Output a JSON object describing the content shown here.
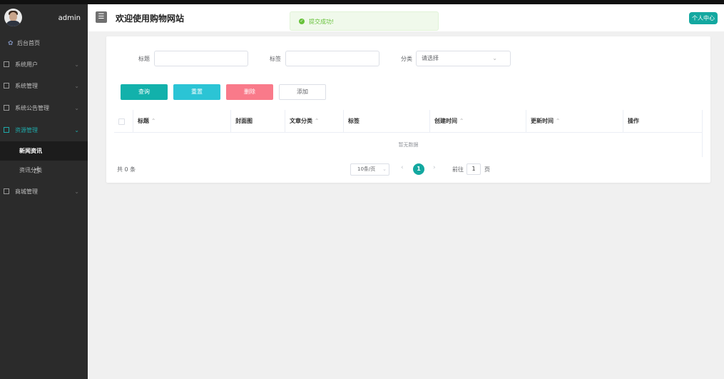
{
  "sidebar": {
    "username": "admin",
    "home_label": "后台首页",
    "menus": [
      {
        "label": "系统用户"
      },
      {
        "label": "系统管理"
      },
      {
        "label": "系统公告管理"
      },
      {
        "label": "资源管理"
      },
      {
        "label": "商城管理"
      }
    ],
    "submenus": [
      {
        "label": "新闻资讯"
      },
      {
        "label": "资讯分类"
      }
    ],
    "chevron": "⌄"
  },
  "header": {
    "menu_toggle": "☰",
    "title": "欢迎使用购物网站",
    "profile_button": "个人中心"
  },
  "toast": {
    "icon": "✓",
    "message": "提交成功!"
  },
  "filters": {
    "title_label": "标题",
    "title_value": "",
    "tag_label": "标签",
    "tag_value": "",
    "category_label": "分类",
    "category_placeholder": "请选择",
    "arrow": "⌄"
  },
  "buttons": {
    "query": "查询",
    "reset": "重置",
    "delete": "删除",
    "add": "添加"
  },
  "table": {
    "columns": [
      "标题",
      "封面图",
      "文章分类",
      "标签",
      "创建时间",
      "更新时间",
      "操作"
    ],
    "sort_icon": "⌃",
    "empty_text": "暂无数据"
  },
  "pagination": {
    "total": "共 0 条",
    "page_size": "10条/页",
    "page_size_arrow": "⌄",
    "prev": "‹",
    "current_page": "1",
    "next": "›",
    "goto_prefix": "前往",
    "goto_value": "1",
    "goto_suffix": "页"
  }
}
